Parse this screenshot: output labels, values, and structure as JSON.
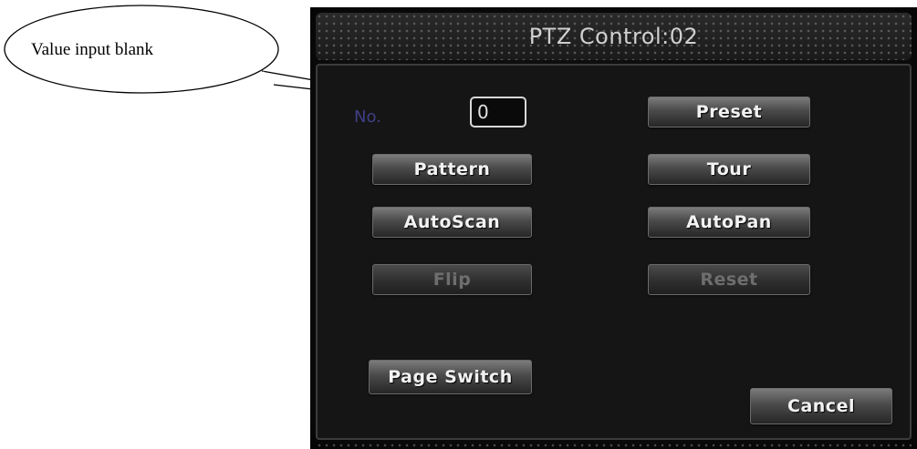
{
  "annotation": {
    "callout_text": "Value input blank"
  },
  "dialog": {
    "title": "PTZ Control:02",
    "no_label": "No.",
    "no_value": "0",
    "buttons": {
      "preset": "Preset",
      "pattern": "Pattern",
      "tour": "Tour",
      "autoscan": "AutoScan",
      "autopan": "AutoPan",
      "flip": "Flip",
      "reset": "Reset",
      "page_switch": "Page Switch",
      "cancel": "Cancel"
    },
    "disabled": [
      "Flip",
      "Reset"
    ]
  }
}
